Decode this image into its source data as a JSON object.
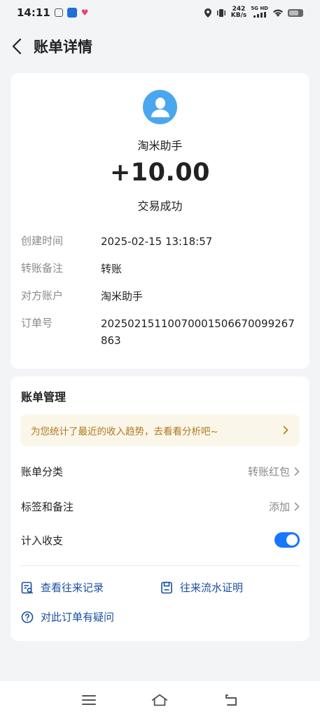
{
  "status_bar": {
    "time": "14:11",
    "speed_value": "242",
    "speed_unit": "KB/s",
    "network": "5G HD"
  },
  "header": {
    "title": "账单详情"
  },
  "transaction": {
    "counterparty": "淘米助手",
    "amount": "+10.00",
    "status": "交易成功",
    "details": [
      {
        "label": "创建时间",
        "value": "2025-02-15 13:18:57"
      },
      {
        "label": "转账备注",
        "value": "转账"
      },
      {
        "label": "对方账户",
        "value": "淘米助手"
      },
      {
        "label": "订单号",
        "value": "20250215110070001506670099267863"
      }
    ]
  },
  "management": {
    "title": "账单管理",
    "banner_text": "为您统计了最近的收入趋势，去看看分析吧~",
    "category_label": "账单分类",
    "category_value": "转账红包",
    "tags_label": "标签和备注",
    "tags_value": "添加",
    "count_label": "计入收支",
    "count_enabled": true,
    "links": {
      "history": "查看往来记录",
      "statement": "往来流水证明",
      "question": "对此订单有疑问"
    }
  },
  "colors": {
    "accent": "#1677ff",
    "avatar": "#4aa7ee",
    "banner_bg": "#fbf6ea",
    "banner_text": "#b07a1f",
    "link": "#1a4fa0"
  },
  "icons": {
    "back": "chevron-left-icon",
    "avatar": "user-icon",
    "location": "location-icon",
    "vibrate": "vibrate-icon",
    "signal": "signal-icon",
    "wifi": "wifi-icon",
    "battery": "battery-icon",
    "history": "record-search-icon",
    "statement": "document-icon",
    "question": "question-icon",
    "menu": "menu-icon",
    "home": "home-icon",
    "return": "return-icon"
  }
}
